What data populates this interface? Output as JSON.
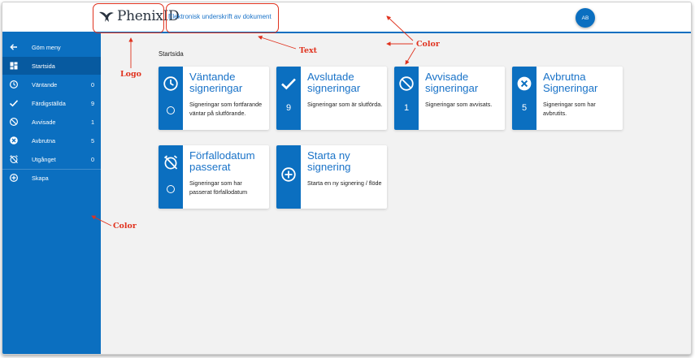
{
  "header": {
    "logo_text": "PhenixID",
    "title": "Elektronisk underskrift av dokument",
    "avatar_initials": "AB"
  },
  "sidebar": {
    "items": [
      {
        "label": "Göm meny",
        "icon": "arrow-left-icon",
        "count": ""
      },
      {
        "label": "Startsida",
        "icon": "dashboard-icon",
        "count": ""
      },
      {
        "label": "Väntande",
        "icon": "clock-icon",
        "count": "0"
      },
      {
        "label": "Färdigställda",
        "icon": "check-icon",
        "count": "9"
      },
      {
        "label": "Avvisade",
        "icon": "block-icon",
        "count": "1"
      },
      {
        "label": "Avbrutna",
        "icon": "cancel-circle-icon",
        "count": "5"
      },
      {
        "label": "Utgånget",
        "icon": "alarm-off-icon",
        "count": "0"
      },
      {
        "label": "Skapa",
        "icon": "add-circle-icon",
        "count": ""
      }
    ]
  },
  "main": {
    "breadcrumb": "Startsida",
    "cards": [
      {
        "title": "Väntande signeringar",
        "value": "",
        "description": "Signeringar som fortfarande väntar på slutförande.",
        "icon": "clock-icon"
      },
      {
        "title": "Avslutade signeringar",
        "value": "9",
        "description": "Signeringar som är slutförda.",
        "icon": "check-icon"
      },
      {
        "title": "Avvisade signeringar",
        "value": "1",
        "description": "Signeringar som avvisats.",
        "icon": "block-icon"
      },
      {
        "title": "Avbrutna Signeringar",
        "value": "5",
        "description": "Signeringar som har avbrutits.",
        "icon": "cancel-circle-icon"
      },
      {
        "title": "Förfallodatum passerat",
        "value": "",
        "description": "Signeringar som har passerat förfallodatum",
        "icon": "alarm-off-icon"
      },
      {
        "title": "Starta ny signering",
        "value": "",
        "description": "Starta en ny signering / flöde",
        "icon": "add-circle-icon"
      }
    ]
  },
  "annotations": {
    "logo": "Logo",
    "text": "Text",
    "color_top": "Color",
    "color_side": "Color"
  },
  "colors": {
    "primary": "#0b6fc0",
    "active": "#075aa0",
    "title_text": "#1a73c8",
    "annotation": "#e0321e",
    "background": "#f2f2f2"
  }
}
